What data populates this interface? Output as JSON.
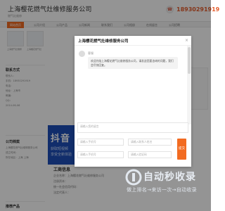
{
  "header": {
    "company_name": "上海樱花燃气灶维修服务公司",
    "company_sub": "燃气灶维修",
    "phone": "18930291919",
    "phone_icon": "phone-icon"
  },
  "nav": {
    "items": [
      "网站首页",
      "公司介绍",
      "公司产品",
      "公司新闻",
      "联系我们",
      "公司相册",
      "在线留言",
      "公司招聘"
    ]
  },
  "sidebar": {
    "thumb_captions": [
      "上海燃气灶维修",
      "上海樱花燃气灶"
    ],
    "contact_title": "联系方式",
    "contact_lines": [
      "联系人：",
      "手机：18930291919",
      "电话：",
      "地址：上海市",
      "邮编：",
      "QQ："
    ],
    "date": "2014-06-06",
    "company_title": "公司档案",
    "company_lines": [
      "上海樱花燃气灶维修服务公司",
      "成立时间：",
      "所在地区：上海 上海"
    ],
    "products_title": "推荐产品"
  },
  "main": {
    "douyin_title": "抖音",
    "douyin_lines": [
      "获取短视频",
      "享受全新体验"
    ],
    "section_title": "工商信息",
    "section_lines": [
      "企业名称：上海樱花燃气灶维修服务公司",
      "注册资本：",
      "统一社会信用代码：",
      "法定代表人："
    ]
  },
  "modal": {
    "title": "上海樱花燃气灶维修服务公司",
    "close_label": "×",
    "sender": "客服",
    "welcome": "欢迎光临上海樱花燃气灶维修服务公司，请发送您要咨询的问题，我们会尽快回复。",
    "message_placeholder": "请输入您的留言",
    "name_placeholder": "请输入手机号",
    "contact_placeholder": "请输入联系人姓名",
    "phone_placeholder": "请输入手机号",
    "code_placeholder": "请输入验证码",
    "submit_label": "提交"
  },
  "watermark": {
    "title": "自动秒收录",
    "subtitle": "做上排名→来访一次→自动收录"
  }
}
